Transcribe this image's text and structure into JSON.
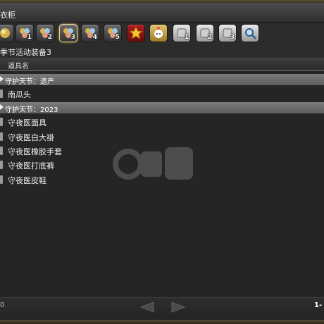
{
  "window": {
    "title": "衣柜"
  },
  "tabs": [
    {
      "name": "tab-1",
      "num": "",
      "active": false
    },
    {
      "name": "tab-2",
      "num": "1",
      "active": false
    },
    {
      "name": "tab-3",
      "num": "2",
      "active": false
    },
    {
      "name": "tab-4",
      "num": "3",
      "active": true
    },
    {
      "name": "tab-5",
      "num": "4",
      "active": false
    },
    {
      "name": "tab-6",
      "num": "5",
      "active": false
    },
    {
      "name": "tab-7-star",
      "num": "",
      "active": false
    },
    {
      "name": "tab-8",
      "num": "",
      "active": false
    },
    {
      "name": "tab-9",
      "num": "1",
      "active": false
    },
    {
      "name": "tab-10",
      "num": "2",
      "active": false
    },
    {
      "name": "tab-11",
      "num": "3",
      "active": false
    },
    {
      "name": "tab-12-search",
      "num": "",
      "active": false
    }
  ],
  "category": {
    "title": "季节活动装备3"
  },
  "list": {
    "column_header": "道具名",
    "groups": [
      {
        "label": "守护天节：遗产",
        "items": [
          "南瓜头"
        ]
      },
      {
        "label": "守护天节：2023",
        "items": [
          "守夜医面具",
          "守夜医白大褂",
          "守夜医橡胶手套",
          "守夜医打底裤",
          "守夜医皮鞋"
        ]
      }
    ]
  },
  "footer": {
    "left_edge_text": "0",
    "pager": "1-"
  },
  "colors": {
    "accent": "#e9d48a",
    "group_bar": "#6e6e6e"
  }
}
